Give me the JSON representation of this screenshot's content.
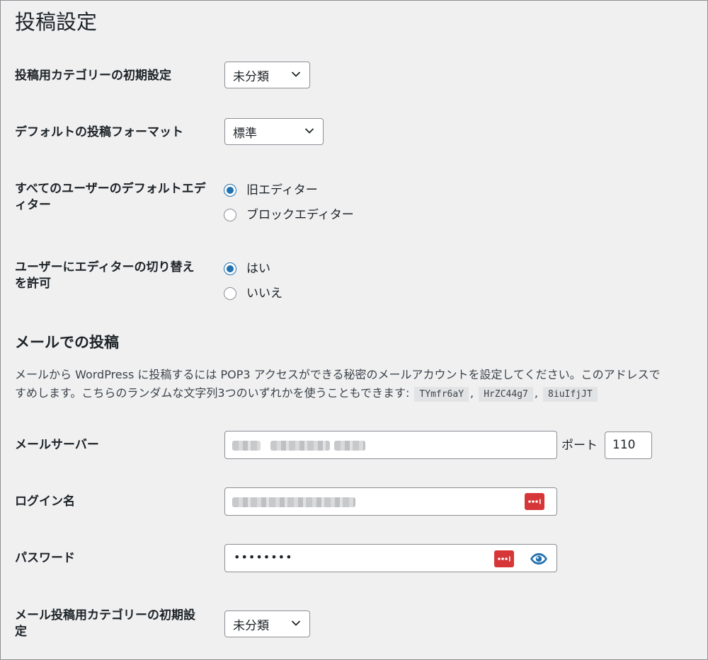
{
  "page_title": "投稿設定",
  "settings": {
    "default_category": {
      "label": "投稿用カテゴリーの初期設定",
      "value": "未分類"
    },
    "default_format": {
      "label": "デフォルトの投稿フォーマット",
      "value": "標準"
    },
    "default_editor": {
      "label": "すべてのユーザーのデフォルトエディター",
      "options": [
        {
          "label": "旧エディター",
          "checked": true
        },
        {
          "label": "ブロックエディター",
          "checked": false
        }
      ]
    },
    "allow_switch": {
      "label": "ユーザーにエディターの切り替えを許可",
      "options": [
        {
          "label": "はい",
          "checked": true
        },
        {
          "label": "いいえ",
          "checked": false
        }
      ]
    }
  },
  "post_via_email": {
    "title": "メールでの投稿",
    "description_line1": "メールから WordPress に投稿するには POP3 アクセスができる秘密のメールアカウントを設定してください。このアドレスで",
    "description_line2": "すめします。こちらのランダムな文字列3つのいずれかを使うこともできます: ",
    "random_strings": [
      "TYmfr6aY",
      "HrZC44g7",
      "8iuIfjJT"
    ],
    "separator": ",",
    "mail_server": {
      "label": "メールサーバー",
      "value": "",
      "port_label": "ポート",
      "port": "110"
    },
    "login_name": {
      "label": "ログイン名",
      "value": ""
    },
    "password": {
      "label": "パスワード",
      "value": "••••••••"
    },
    "default_mail_category": {
      "label": "メール投稿用カテゴリーの初期設定",
      "value": "未分類"
    }
  },
  "icons": {
    "select_arrow": "chevron-down-icon",
    "password_manager": "password-manager-icon",
    "show_password": "eye-icon"
  },
  "colors": {
    "accent": "#2271b1",
    "password_manager": "#d63638",
    "background": "#f0f0f1"
  }
}
